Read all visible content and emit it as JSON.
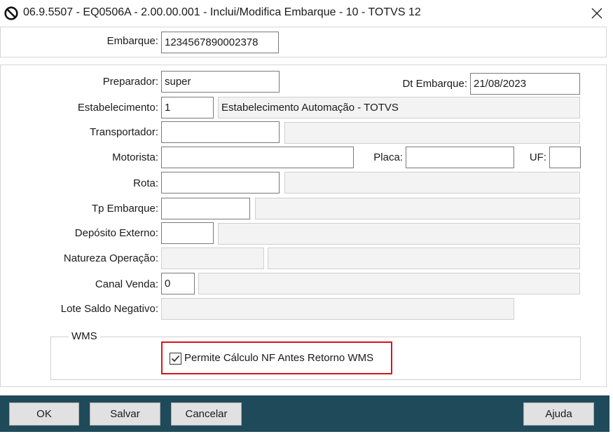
{
  "window": {
    "title": "06.9.5507 - EQ0506A - 2.00.00.001 - Inclui/Modifica Embarque - 10 - TOTVS 12",
    "app_icon": "totvs-logo-icon",
    "close_icon": "close-icon"
  },
  "embarque": {
    "label": "Embarque:",
    "value": "1234567890002378"
  },
  "form": {
    "preparador": {
      "label": "Preparador:",
      "value": "super"
    },
    "dt_embarque": {
      "label": "Dt Embarque:",
      "value": "21/08/2023"
    },
    "estabelecimento": {
      "label": "Estabelecimento:",
      "value": "1",
      "description": "Estabelecimento Automação - TOTVS"
    },
    "transportador": {
      "label": "Transportador:",
      "value": "",
      "description": ""
    },
    "motorista": {
      "label": "Motorista:",
      "value": ""
    },
    "placa": {
      "label": "Placa:",
      "value": ""
    },
    "uf": {
      "label": "UF:",
      "value": ""
    },
    "rota": {
      "label": "Rota:",
      "value": "",
      "description": ""
    },
    "tp_embarque": {
      "label": "Tp Embarque:",
      "value": "",
      "description": ""
    },
    "deposito_externo": {
      "label": "Depósito Externo:",
      "value": "",
      "description": ""
    },
    "natureza_operacao": {
      "label": "Natureza Operação:",
      "value": "",
      "description": ""
    },
    "canal_venda": {
      "label": "Canal Venda:",
      "value": "0",
      "description": ""
    },
    "lote_saldo_negativo": {
      "label": "Lote Saldo Negativo:",
      "value": ""
    }
  },
  "wms": {
    "title": "WMS",
    "checkbox_label": "Permite Cálculo NF Antes Retorno WMS",
    "checked": true,
    "highlight_color": "#d9141b"
  },
  "footer": {
    "background": "#1f4a5a",
    "ok_label": "OK",
    "salvar_label": "Salvar",
    "cancelar_label": "Cancelar",
    "ajuda_label": "Ajuda"
  }
}
